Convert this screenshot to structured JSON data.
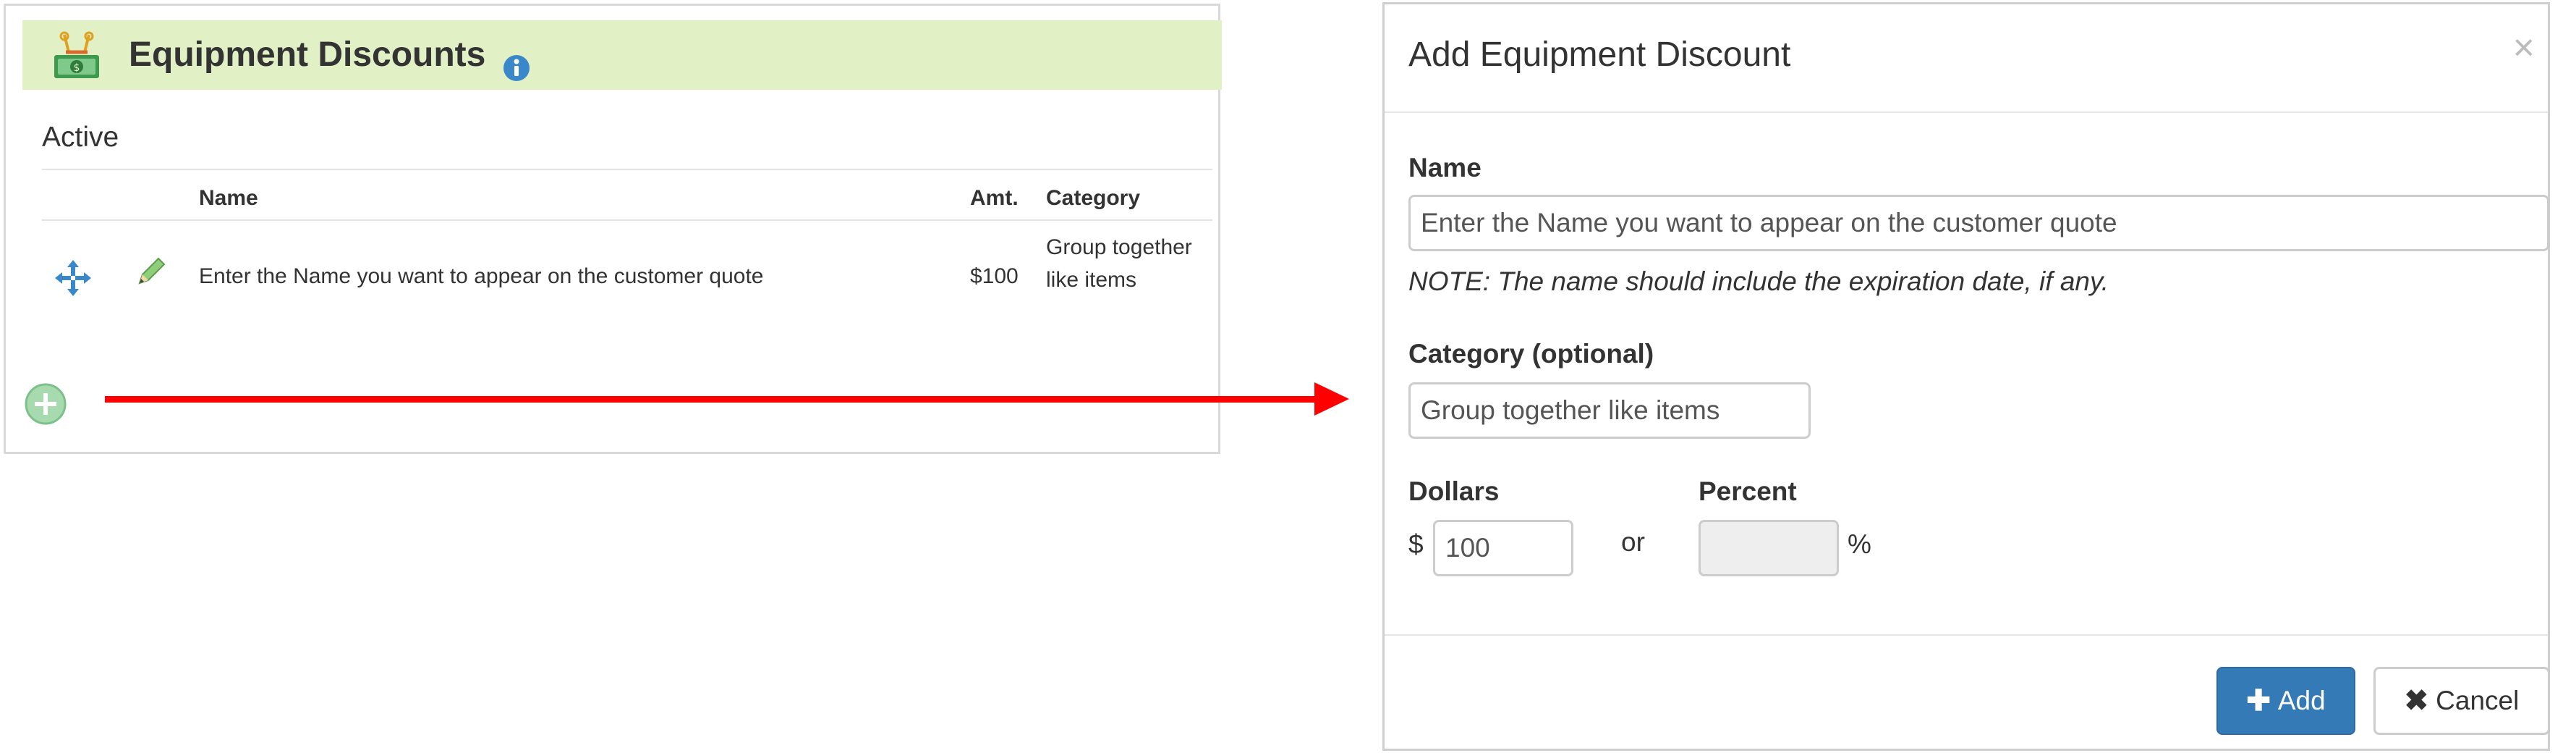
{
  "panel": {
    "title": "Equipment Discounts",
    "header_icon": "money-discount-icon",
    "info_icon": "info-icon",
    "section_label": "Active",
    "table": {
      "columns": [
        "",
        "",
        "Name",
        "Amt.",
        "Category"
      ],
      "rows": [
        {
          "move_icon": "move-arrows-icon",
          "edit_icon": "pencil-icon",
          "name": "Enter the Name you want to appear on the customer quote",
          "amount": "$100",
          "category": "Group together like items"
        }
      ]
    },
    "add_icon": "plus-circle-icon"
  },
  "annotation": {
    "arrow_color": "#ff0000"
  },
  "modal": {
    "title": "Add Equipment Discount",
    "close_glyph": "×",
    "name_label": "Name",
    "name_value": "Enter the Name you want to appear on the customer quote",
    "name_note": "NOTE: The name should include the expiration date, if any.",
    "category_label": "Category (optional)",
    "category_value": "Group together like items",
    "dollars_label": "Dollars",
    "dollars_prefix": "$",
    "dollars_value": "100",
    "or_text": "or",
    "percent_label": "Percent",
    "percent_value": "",
    "percent_suffix": "%",
    "add_button_label": "Add",
    "cancel_button_label": "Cancel"
  },
  "colors": {
    "header_bg": "#e2f0c5",
    "primary": "#337ab7",
    "icon_blue": "#3a87c9",
    "add_green": "#9fd6a8"
  }
}
